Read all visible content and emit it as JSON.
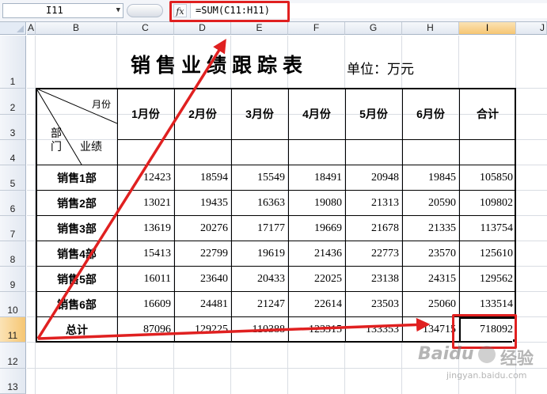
{
  "formula_bar": {
    "name_box": "I11",
    "fx_label": "fx",
    "formula": "=SUM(C11:H11)"
  },
  "columns": [
    "A",
    "B",
    "C",
    "D",
    "E",
    "F",
    "G",
    "H",
    "I",
    "J"
  ],
  "rows": [
    "1",
    "2",
    "3",
    "4",
    "5",
    "6",
    "7",
    "8",
    "9",
    "10",
    "11",
    "12",
    "13"
  ],
  "sheet": {
    "title": "销售业绩跟踪表",
    "unit": "单位：万元",
    "corner_month": "月份",
    "corner_dept": "部\n门",
    "corner_perf": "业绩",
    "months": [
      "1月份",
      "2月份",
      "3月份",
      "4月份",
      "5月份",
      "6月份",
      "合计"
    ],
    "departments": [
      {
        "name": "销售1部",
        "values": [
          "12423",
          "18594",
          "15549",
          "18491",
          "20948",
          "19845",
          "105850"
        ]
      },
      {
        "name": "销售2部",
        "values": [
          "13021",
          "19435",
          "16363",
          "19080",
          "21313",
          "20590",
          "109802"
        ]
      },
      {
        "name": "销售3部",
        "values": [
          "13619",
          "20276",
          "17177",
          "19669",
          "21678",
          "21335",
          "113754"
        ]
      },
      {
        "name": "销售4部",
        "values": [
          "15413",
          "22799",
          "19619",
          "21436",
          "22773",
          "23570",
          "125610"
        ]
      },
      {
        "name": "销售5部",
        "values": [
          "16011",
          "23640",
          "20433",
          "22025",
          "23138",
          "24315",
          "129562"
        ]
      },
      {
        "name": "销售6部",
        "values": [
          "16609",
          "24481",
          "21247",
          "22614",
          "23503",
          "25060",
          "133514"
        ]
      }
    ],
    "total": {
      "name": "总计",
      "values": [
        "87096",
        "129225",
        "110388",
        "123315",
        "133353",
        "134715",
        "718092"
      ]
    }
  },
  "watermark": {
    "logo": "Baidu",
    "sub": "jingyan.baidu.com",
    "suffix": "经验"
  },
  "colors": {
    "annotation": "#e02020",
    "header_active": "#f6c673"
  }
}
